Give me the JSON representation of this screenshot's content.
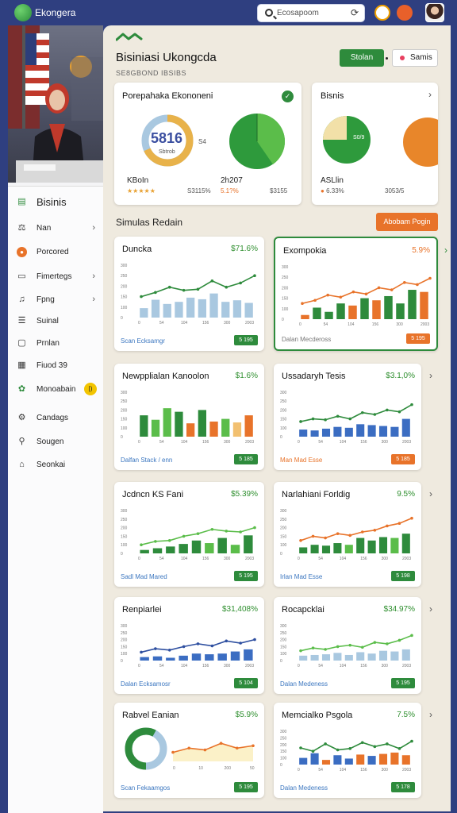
{
  "app": {
    "name": "Ekongera",
    "search_placeholder": "Ecosapoom"
  },
  "sidebar": {
    "items": [
      {
        "label": "Bisinis",
        "icon": "document-icon"
      },
      {
        "label": "Nan",
        "icon": "scales-icon",
        "chevron": true
      },
      {
        "label": "Porcored",
        "icon": "circle-badge-icon"
      },
      {
        "label": "Fimertegs",
        "icon": "clipboard-icon",
        "chevron": true
      },
      {
        "label": "Fpng",
        "icon": "bell-icon",
        "chevron": true
      },
      {
        "label": "Suinal",
        "icon": "list-icon"
      },
      {
        "label": "Prnlan",
        "icon": "box-icon"
      },
      {
        "label": "Fiuod 39",
        "icon": "calendar-icon"
      },
      {
        "label": "Monoabain",
        "icon": "people-icon"
      },
      {
        "label": "Candags",
        "icon": "gear-icon"
      },
      {
        "label": "Sougen",
        "icon": "search-icon"
      },
      {
        "label": "Seonkai",
        "icon": "home-icon"
      }
    ]
  },
  "header": {
    "title": "Bisiniasi Ukongcda",
    "subtitle": "SE8GBOND IBSIBS",
    "primary_button": "Stolan",
    "secondary_button": "Samis"
  },
  "summary": {
    "card1": {
      "title": "Porepahaka Ekononeni",
      "donut_value": "5816",
      "donut_sub": "Sbtrob",
      "donut_side": "S4",
      "stat1_label": "KBoIn",
      "stat1_sub": "S3115%",
      "stat2_label": "2h207",
      "stat2_sub": "5.1?%",
      "stat2_value": "$3155",
      "rating": "★★★★★"
    },
    "card2": {
      "title": "Bisnis",
      "pie_label": "S0/9",
      "stat1_label": "ASLlin",
      "stat1_sub": "6.33%",
      "stat2_sub": "3053/5"
    }
  },
  "section": {
    "title": "Simulas Redain",
    "button": "Abobam Pogin"
  },
  "charts": [
    {
      "title": "Duncka",
      "value": "$71.6%",
      "foot": "Scan Ecksamgr",
      "badge": "5 195"
    },
    {
      "title": "Exompokia",
      "value": "5.9%",
      "foot": "Dalan Mecdeross",
      "badge": "5 195"
    },
    {
      "title": "Newpplialan Kanoolon",
      "value": "$1.6%",
      "foot": "Dalfan Stack / enn",
      "badge": "5 185"
    },
    {
      "title": "Ussadaryh Tesis",
      "value": "$3.1,0%",
      "foot": "Man Mad Esse",
      "badge": "5 185"
    },
    {
      "title": "Jcdncn KS Fani",
      "value": "$5.39%",
      "foot": "Sadl Mad Mared",
      "badge": "5 195"
    },
    {
      "title": "Narlahiani Forldig",
      "value": "9.5%",
      "foot": "Irlan Mad Esse",
      "badge": "5 198"
    },
    {
      "title": "Renpiarlei",
      "value": "$31,408%",
      "foot": "Dalan Ecksamosr",
      "badge": "5 104"
    },
    {
      "title": "Rocapcklai",
      "value": "$34.97%",
      "foot": "Dalan Medeness",
      "badge": "5 195"
    },
    {
      "title": "Rabvel Eanian",
      "value": "$5.9%",
      "foot": "Scan Fekaamgos",
      "badge": "5 195"
    },
    {
      "title": "Memcialko Psgola",
      "value": "7.5%",
      "foot": "Dalan Medeness",
      "badge": "5 178"
    }
  ],
  "axis": {
    "y": [
      "300",
      "250",
      "200",
      "150",
      "100",
      "0"
    ],
    "x": [
      "0",
      "54",
      "104",
      "156",
      "300",
      "2003"
    ]
  },
  "colors": {
    "green": "#2e8b3c",
    "lightgreen": "#5bbd4a",
    "orange": "#e8732a",
    "blue": "#3b6dc2",
    "lightblue": "#a9c8e0",
    "navy": "#2f3f80"
  }
}
